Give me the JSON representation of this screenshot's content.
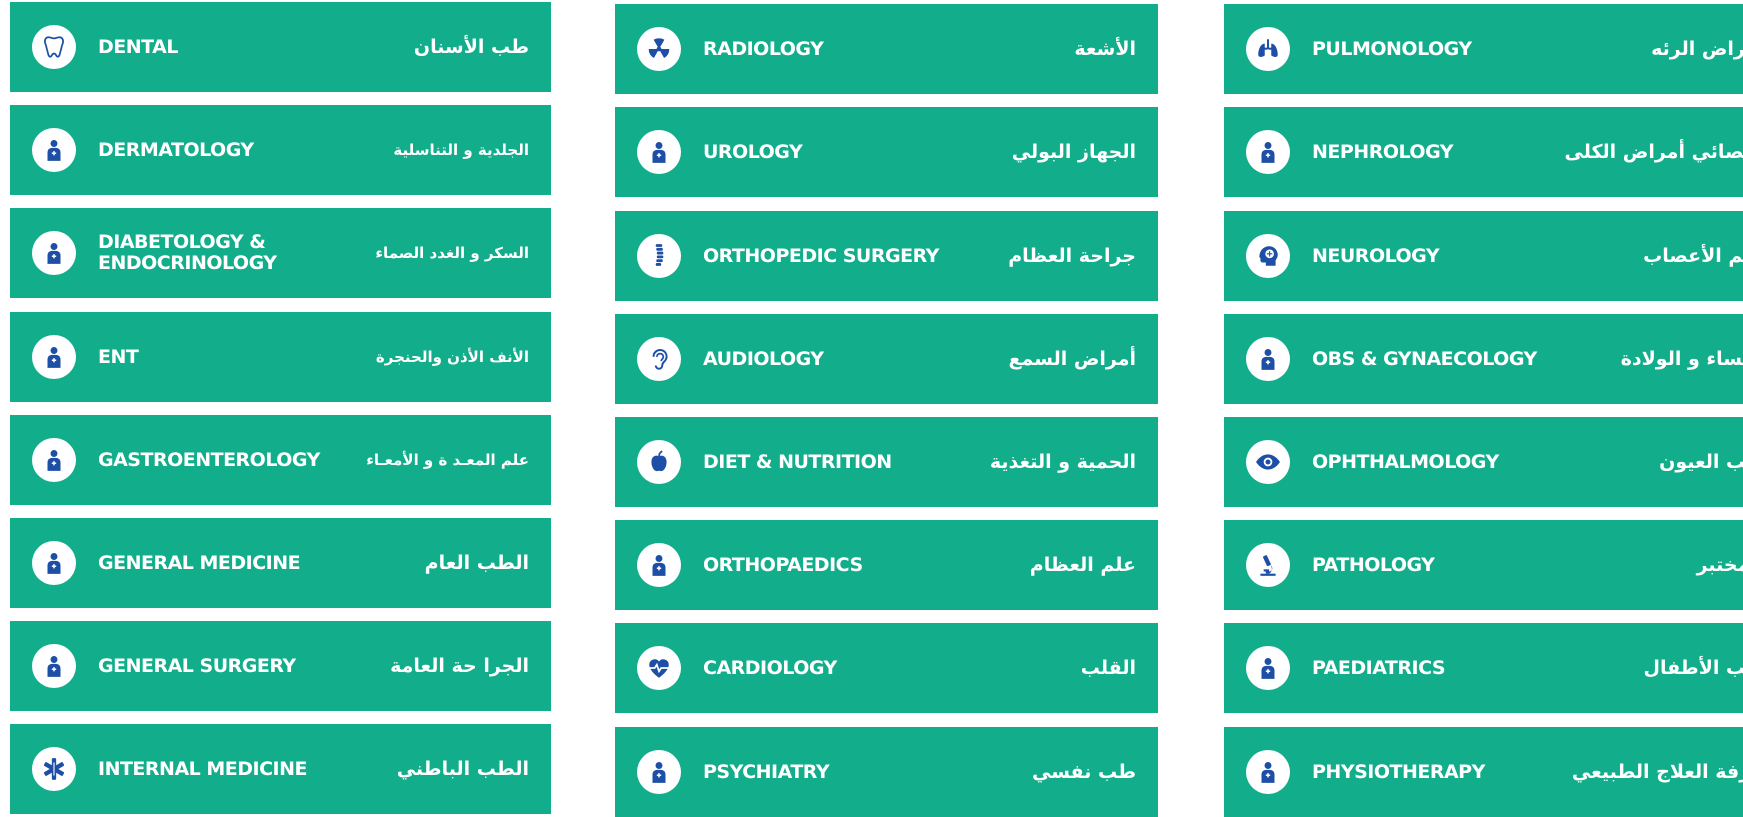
{
  "columns": [
    {
      "cards": [
        {
          "en": "DENTAL",
          "ar": "طب الأسنان",
          "icon": "tooth-icon"
        },
        {
          "en": "DERMATOLOGY",
          "ar": "الجلدية و التناسلية",
          "icon": "skin-icon"
        },
        {
          "en": "DIABETOLOGY &\nENDOCRINOLOGY",
          "ar": "السكر و الغدد الصماء",
          "icon": "clipboard-patient-icon"
        },
        {
          "en": "ENT",
          "ar": "الأنف الأذن والحنجرة",
          "icon": "ear-nose-throat-icon"
        },
        {
          "en": "GASTROENTEROLOGY",
          "ar": "علم المعـد ة و الأمعـاء",
          "icon": "stomach-icon"
        },
        {
          "en": "GENERAL MEDICINE",
          "ar": "الطب العام",
          "icon": "caduceus-icon"
        },
        {
          "en": "GENERAL SURGERY",
          "ar": "الجرا حة العامة",
          "icon": "surgeon-icon"
        },
        {
          "en": "INTERNAL MEDICINE",
          "ar": "الطب الباطني",
          "icon": "star-of-life-icon"
        }
      ]
    },
    {
      "cards": [
        {
          "en": "RADIOLOGY",
          "ar": "الأشعة",
          "icon": "radiation-icon"
        },
        {
          "en": "UROLOGY",
          "ar": "الجهاز البولي",
          "icon": "kidneys-icon"
        },
        {
          "en": "ORTHOPEDIC SURGERY",
          "ar": "جراحة العظام",
          "icon": "spine-icon"
        },
        {
          "en": "AUDIOLOGY",
          "ar": "أمراض السمع",
          "icon": "ear-icon"
        },
        {
          "en": "DIET & NUTRITION",
          "ar": "الحمية و التغذية",
          "icon": "apple-icon"
        },
        {
          "en": "ORTHOPAEDICS",
          "ar": "علم العظام",
          "icon": "arm-sling-icon"
        },
        {
          "en": "CARDIOLOGY",
          "ar": "القلب",
          "icon": "heart-pulse-icon"
        },
        {
          "en": "PSYCHIATRY",
          "ar": "طب نفسي",
          "icon": "head-cross-icon"
        }
      ]
    },
    {
      "cards": [
        {
          "en": "PULMONOLOGY",
          "ar": "أمراض الرئه",
          "icon": "lungs-icon"
        },
        {
          "en": "NEPHROLOGY",
          "ar": "أخصائي أمراض الكلى",
          "icon": "body-kidneys-icon"
        },
        {
          "en": "NEUROLOGY",
          "ar": "علم الأعصاب",
          "icon": "brain-head-icon"
        },
        {
          "en": "OBS & GYNAECOLOGY",
          "ar": "النساء و الولادة",
          "icon": "pregnancy-icon"
        },
        {
          "en": "OPHTHALMOLOGY",
          "ar": "طب العيون",
          "icon": "eye-icon"
        },
        {
          "en": "PATHOLOGY",
          "ar": "المختبر",
          "icon": "microscope-icon"
        },
        {
          "en": "PAEDIATRICS",
          "ar": "طب الأطفال",
          "icon": "mother-child-icon"
        },
        {
          "en": "PHYSIOTHERAPY",
          "ar": "غرفة العلاج الطبيعي",
          "icon": "physiotherapy-icon"
        }
      ]
    }
  ],
  "colors": {
    "card_bg": "#12ad8b",
    "icon_fg": "#1e4fa6",
    "text": "#ffffff"
  }
}
